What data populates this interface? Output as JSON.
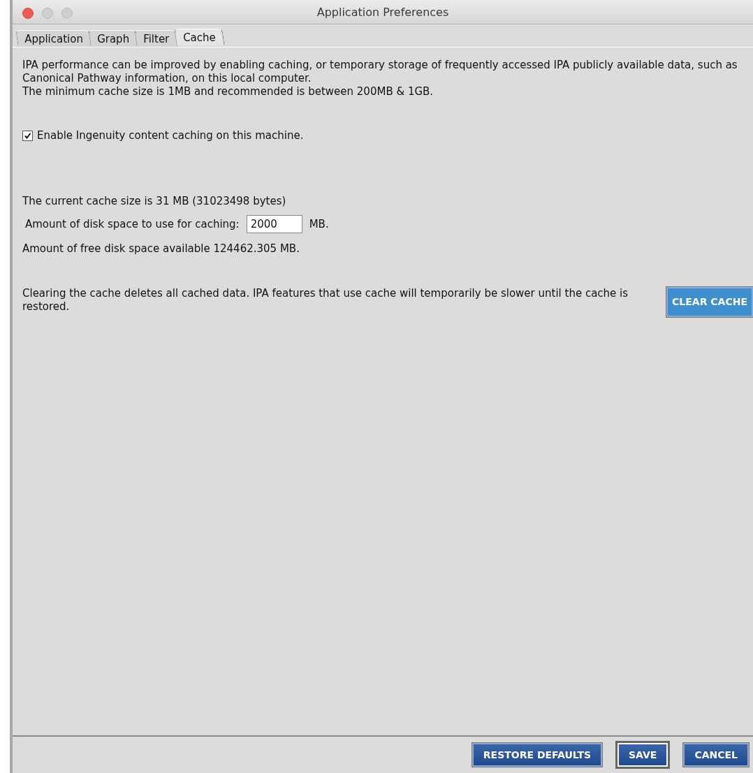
{
  "window": {
    "title": "Application Preferences"
  },
  "tabs": [
    {
      "label": "Application",
      "selected": false
    },
    {
      "label": "Graph",
      "selected": false
    },
    {
      "label": "Filter",
      "selected": false
    },
    {
      "label": "Cache",
      "selected": true
    }
  ],
  "intro": [
    "IPA performance can be improved by enabling caching, or temporary storage of frequently accessed IPA publicly available data, such as Canonical Pathway information, on this local computer.",
    "The minimum cache size is 1MB and recommended is between 200MB & 1GB."
  ],
  "enable_caching": {
    "label": "Enable Ingenuity content caching on this machine.",
    "checked": true
  },
  "current_size": "The current cache size is 31 MB (31023498 bytes)",
  "disk_space": {
    "label": "Amount of disk space to use for caching:",
    "value": "2000",
    "unit": "MB."
  },
  "free_space": "Amount of free disk space available 124462.305 MB.",
  "clear": {
    "text": "Clearing the cache deletes all cached data. IPA features that use cache will temporarily be slower until the cache is restored.",
    "button": "CLEAR CACHE"
  },
  "buttons": [
    {
      "label": "RESTORE DEFAULTS",
      "selected": false
    },
    {
      "label": "SAVE",
      "selected": true
    },
    {
      "label": "CANCEL",
      "selected": false
    }
  ]
}
